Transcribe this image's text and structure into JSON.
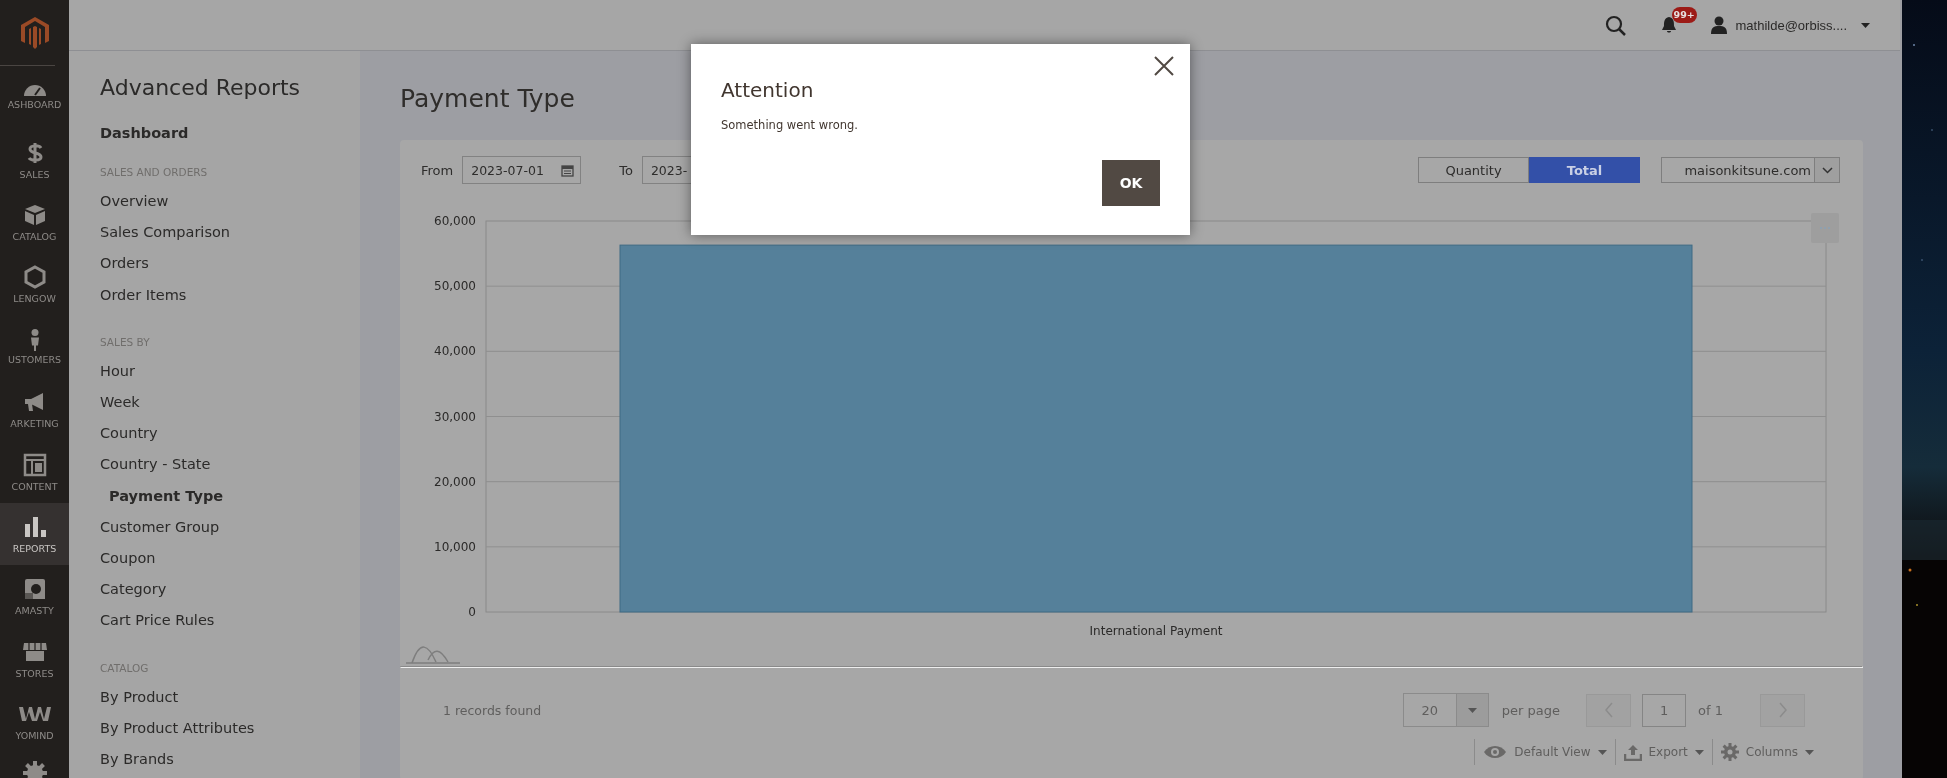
{
  "nav": {
    "items": [
      {
        "label": "ASHBOARD",
        "selected": false
      },
      {
        "label": "SALES",
        "selected": false
      },
      {
        "label": "CATALOG",
        "selected": false
      },
      {
        "label": "LENGOW",
        "selected": false
      },
      {
        "label": "USTOMERS",
        "selected": false
      },
      {
        "label": "ARKETING",
        "selected": false
      },
      {
        "label": "CONTENT",
        "selected": false
      },
      {
        "label": "REPORTS",
        "selected": true
      },
      {
        "label": "AMASTY",
        "selected": false
      },
      {
        "label": "STORES",
        "selected": false
      },
      {
        "label": "YOMIND",
        "selected": false
      }
    ]
  },
  "header": {
    "notifications_badge": "99+",
    "user": "mathilde@orbiss...."
  },
  "sidebar": {
    "title": "Advanced Reports",
    "top_link": "Dashboard",
    "sections": [
      {
        "heading": "SALES AND ORDERS",
        "items": [
          {
            "label": "Overview",
            "selected": false
          },
          {
            "label": "Sales Comparison",
            "selected": false
          },
          {
            "label": "Orders",
            "selected": false
          },
          {
            "label": "Order Items",
            "selected": false
          }
        ]
      },
      {
        "heading": "SALES BY",
        "items": [
          {
            "label": "Hour",
            "selected": false
          },
          {
            "label": "Week",
            "selected": false
          },
          {
            "label": "Country",
            "selected": false
          },
          {
            "label": "Country - State",
            "selected": false
          },
          {
            "label": "Payment Type",
            "selected": true
          },
          {
            "label": "Customer Group",
            "selected": false
          },
          {
            "label": "Coupon",
            "selected": false
          },
          {
            "label": "Category",
            "selected": false
          },
          {
            "label": "Cart Price Rules",
            "selected": false
          }
        ]
      },
      {
        "heading": "CATALOG",
        "items": [
          {
            "label": "By Product",
            "selected": false
          },
          {
            "label": "By Product Attributes",
            "selected": false
          },
          {
            "label": "By Brands",
            "selected": false
          }
        ]
      }
    ]
  },
  "page_title": "Payment Type",
  "filters": {
    "from_label": "From",
    "from_value": "2023-07-01",
    "to_label": "To",
    "to_value": "2023-",
    "metric_toggle": [
      {
        "label": "Quantity",
        "selected": false
      },
      {
        "label": "Total",
        "selected": true
      }
    ],
    "store": "maisonkitsune.com"
  },
  "chart_data": {
    "type": "bar",
    "categories": [
      "International Payment"
    ],
    "values": [
      56300
    ],
    "ylim": [
      0,
      60000
    ],
    "grid": true,
    "yticks": [
      {
        "value": 0,
        "label": "0"
      },
      {
        "value": 10000,
        "label": "10,000"
      },
      {
        "value": 20000,
        "label": "20,000"
      },
      {
        "value": 30000,
        "label": "30,000"
      },
      {
        "value": 40000,
        "label": "40,000"
      },
      {
        "value": 50000,
        "label": "50,000"
      },
      {
        "value": 60000,
        "label": "60,000"
      }
    ]
  },
  "footer": {
    "records": "1 records found",
    "per_page_value": "20",
    "per_page_label": "per page",
    "page": "1",
    "page_of": "of 1",
    "actions": [
      "Default View",
      "Export",
      "Columns"
    ]
  },
  "modal": {
    "title": "Attention",
    "message": "Something went wrong.",
    "button": "OK"
  }
}
